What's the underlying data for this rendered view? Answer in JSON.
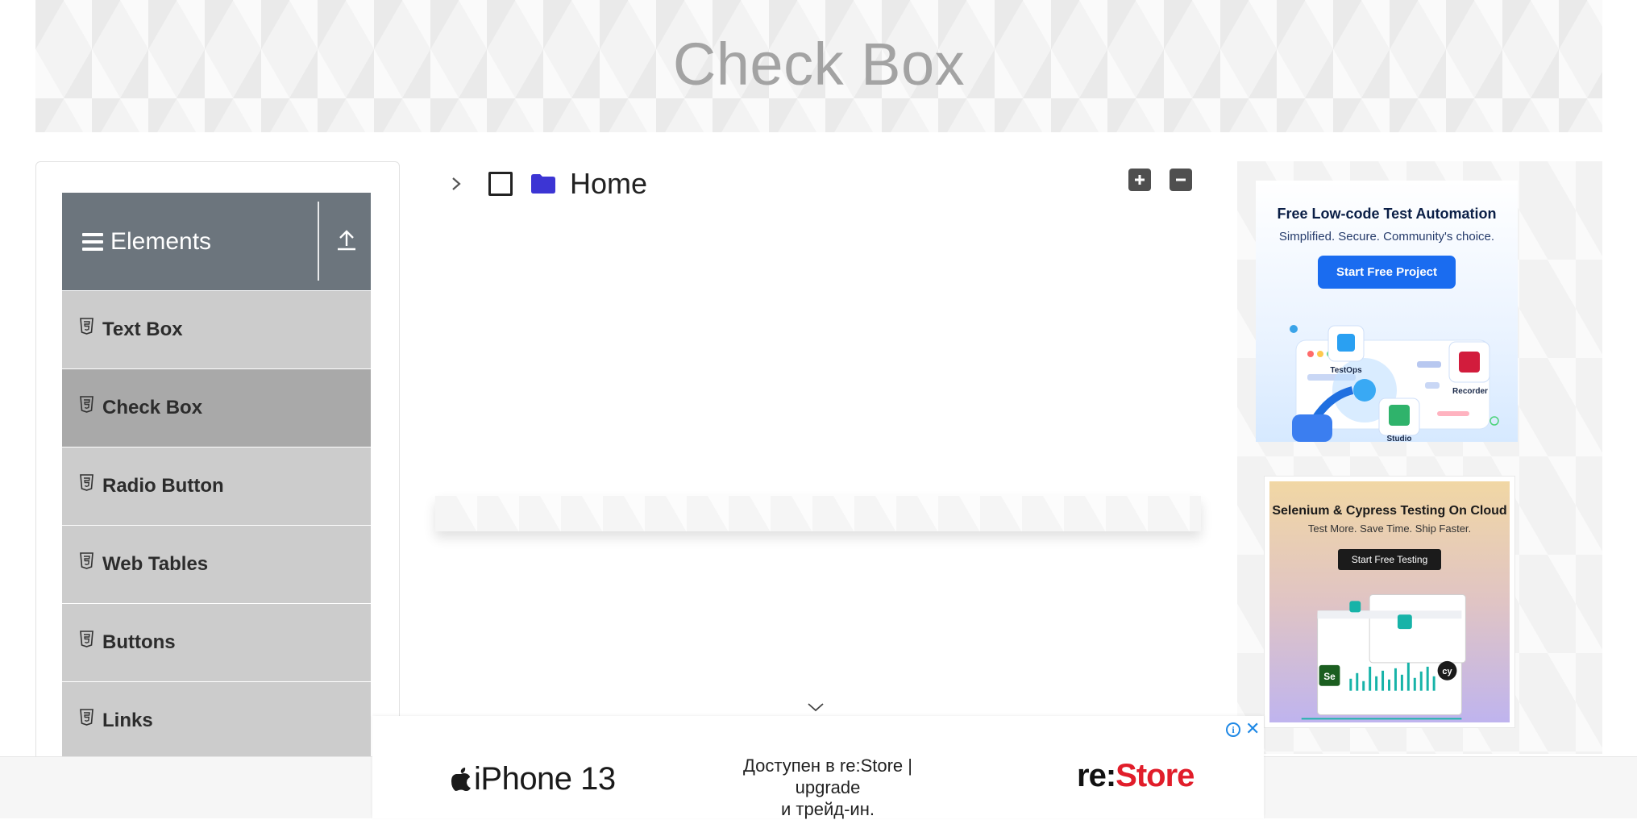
{
  "page": {
    "title": "Check Box"
  },
  "sidebar": {
    "group_title": "Elements",
    "items": [
      {
        "label": "Text Box",
        "active": false
      },
      {
        "label": "Check Box",
        "active": true
      },
      {
        "label": "Radio Button",
        "active": false
      },
      {
        "label": "Web Tables",
        "active": false
      },
      {
        "label": "Buttons",
        "active": false
      },
      {
        "label": "Links",
        "active": false
      }
    ]
  },
  "tree": {
    "root_label": "Home",
    "root_checked": false,
    "root_expanded": false,
    "folder_color": "#3c35d4"
  },
  "ads": {
    "right_top": {
      "headline": "Free Low-code Test Automation",
      "sub": "Simplified. Secure. Community's choice.",
      "cta": "Start Free Project",
      "badges": [
        "TestOps",
        "Recorder",
        "Studio"
      ]
    },
    "right_bottom": {
      "headline": "Selenium & Cypress Testing On Cloud",
      "sub": "Test More. Save Time. Ship Faster.",
      "cta": "Start Free Testing"
    },
    "bottom": {
      "product": "iPhone 13",
      "tagline_line1": "Доступен в re:Store | upgrade",
      "tagline_line2": "и трейд-ин.",
      "brand_prefix": "re:",
      "brand_suffix": "Store"
    }
  },
  "colors": {
    "sidebar_header": "#6c757d",
    "menu_item": "#cccccc",
    "menu_item_active": "#a9a9a9",
    "ad_cta_blue": "#1a6cf0",
    "brand_red": "#e11d2a"
  }
}
